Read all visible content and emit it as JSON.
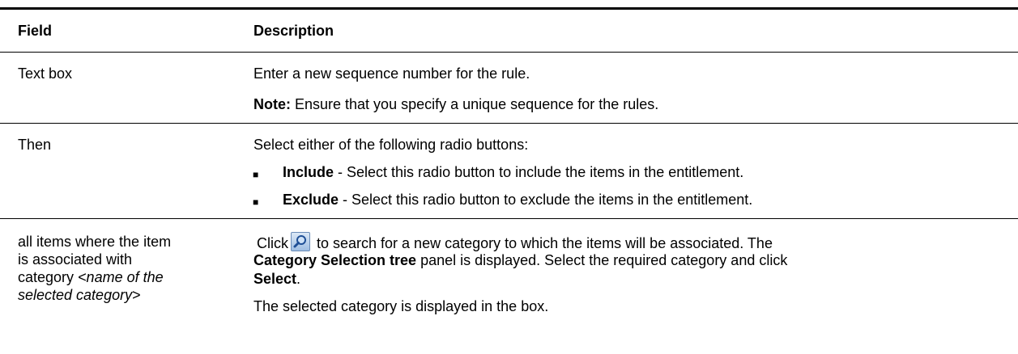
{
  "header": {
    "field": "Field",
    "description": "Description"
  },
  "rows": [
    {
      "field": "Text box",
      "desc_1": "Enter a new sequence number for the rule.",
      "note_label": "Note:",
      "note_text": " Ensure that you specify a unique sequence for the rules."
    },
    {
      "field": "Then",
      "intro": "Select either of the following radio buttons:",
      "bullets": [
        {
          "term": "Include",
          "text": " - Select this radio button to include the items in the entitlement."
        },
        {
          "term": "Exclude",
          "text": " - Select this radio button to exclude the items in the entitlement."
        }
      ]
    },
    {
      "field_line1": "all items where the item",
      "field_line2": "is associated with",
      "field_line3_plain": "category ",
      "field_line3_italic": "<name of the",
      "field_line4_italic": "selected category",
      "field_line4_plain": ">",
      "click_word": "Click",
      "line1_rest": " to search for a new category to which the items will be associated. The",
      "line2_bold": "Category Selection tree",
      "line2_rest": " panel is displayed. Select the required category and click",
      "line3_bold": "Select",
      "line3_rest": ".",
      "line4": "The selected category is displayed in the box."
    }
  ],
  "icons": {
    "search_icon": "magnifier-icon",
    "bullet": "■"
  },
  "colors": {
    "icon_blue": "#3a6fb5"
  }
}
